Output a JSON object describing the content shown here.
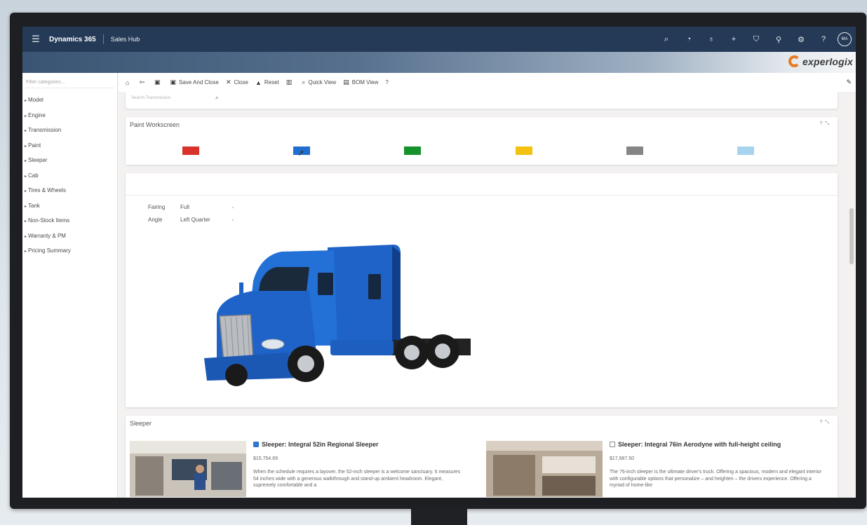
{
  "topnav": {
    "brand": "Dynamics 365",
    "app": "Sales Hub",
    "icons": [
      "search-icon",
      "lightbulb-icon",
      "location-icon",
      "plus-icon",
      "filter-icon",
      "assist-icon",
      "settings-icon",
      "help-icon"
    ],
    "avatar": "MA"
  },
  "banner": {
    "logo_text": "experlogix",
    "accent": "#ea7a1f"
  },
  "sidebar": {
    "filter_placeholder": "Filter categories...",
    "categories": [
      "Model",
      "Engine",
      "Transmission",
      "Paint",
      "Sleeper",
      "Cab",
      "Tires & Wheels",
      "Tank",
      "Non-Stock Items",
      "Warranty & PM",
      "Pricing Summary"
    ]
  },
  "toolbar": {
    "save_and_close": "Save And Close",
    "close": "Close",
    "reset": "Reset",
    "quick_view": "Quick View",
    "bom_view": "BOM View",
    "help": "?"
  },
  "search": {
    "placeholder": "Search Transmission"
  },
  "paint": {
    "title": "Paint Workscreen",
    "swatches": [
      {
        "name": "red",
        "color": "#d9322a"
      },
      {
        "name": "blue",
        "color": "#1f6fd1"
      },
      {
        "name": "green",
        "color": "#15922b"
      },
      {
        "name": "yellow",
        "color": "#f2c20f"
      },
      {
        "name": "gray",
        "color": "#858585"
      },
      {
        "name": "light-blue",
        "color": "#a6d4ee"
      }
    ]
  },
  "preview": {
    "fairing_label": "Fairing",
    "fairing_value": "Full",
    "angle_label": "Angle",
    "angle_value": "Left Quarter",
    "truck_color": "#1f63c8"
  },
  "sleeper": {
    "title": "Sleeper",
    "items": [
      {
        "name": "Sleeper: Integral 52in Regional Sleeper",
        "price": "$15,754.69",
        "selected": true,
        "desc": "When the schedule requires a layover, the 52-inch sleeper is a welcome sanctuary. It measures 54 inches wide with a generous walkthrough and stand-up ambient headroom. Elegant, supremely comfortable and a"
      },
      {
        "name": "Sleeper: Integral 76in Aerodyne with full-height ceiling",
        "price": "$17,687.50",
        "selected": false,
        "desc": "The 76-inch sleeper is the ultimate driver's truck. Offering a spacious, modern and elegant interior with configurable options that personalize – and heighten – the drivers experience. Offering a myriad of home-like"
      }
    ]
  }
}
